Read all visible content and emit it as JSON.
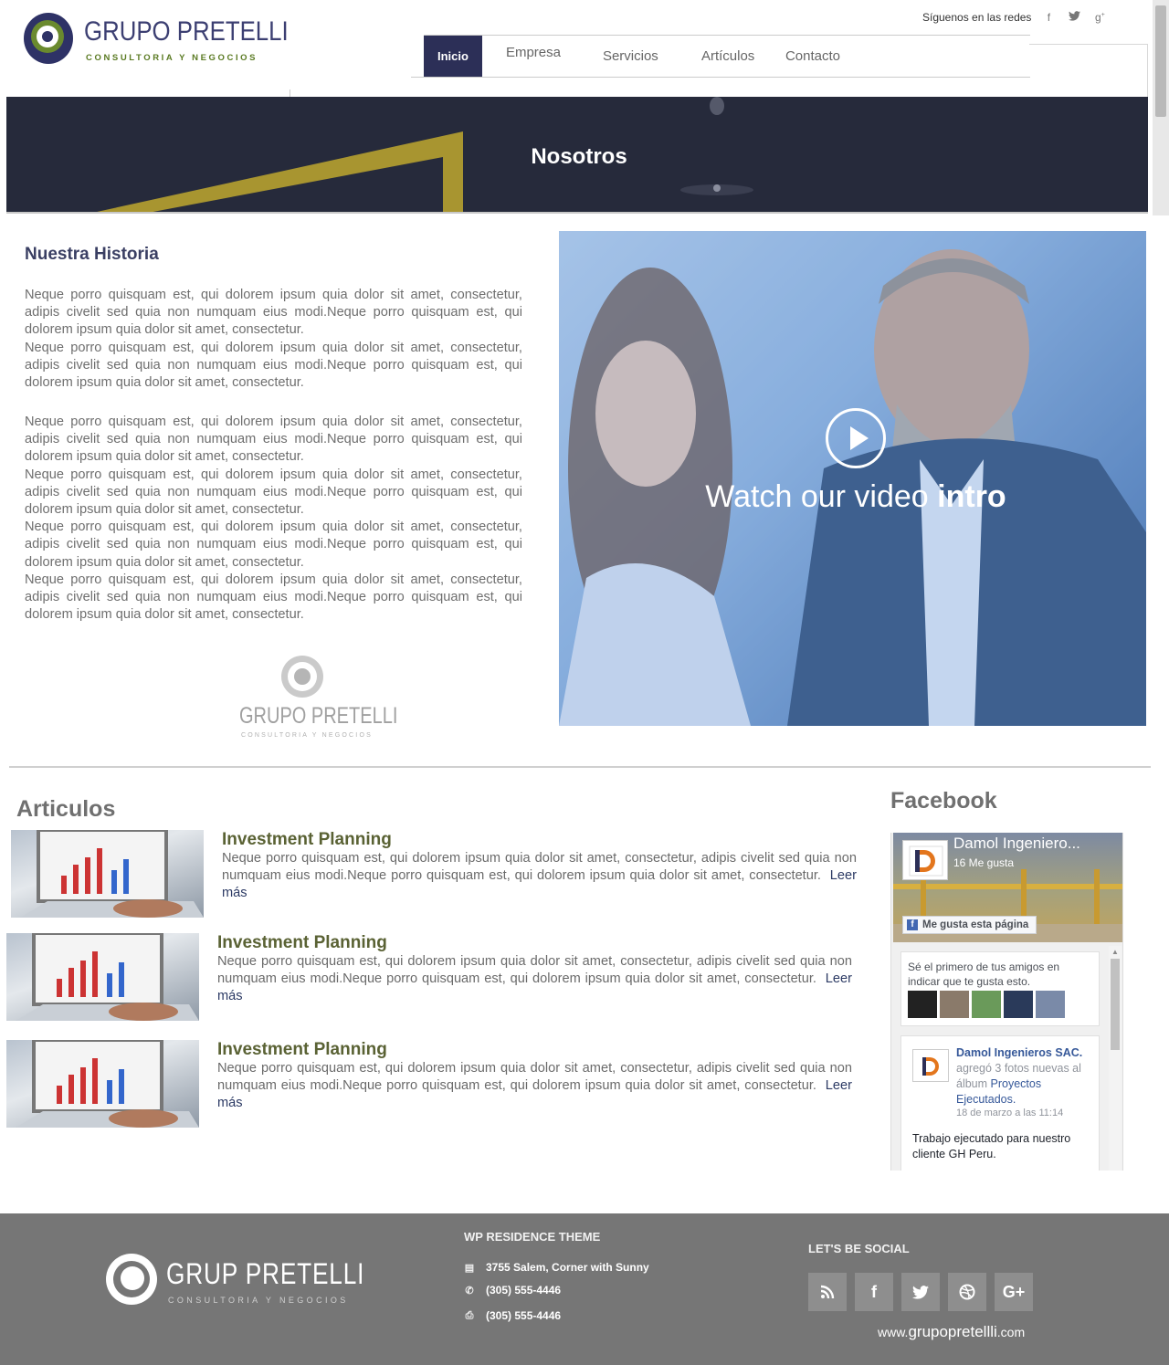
{
  "brand": {
    "name": "GRUPO PRETELLI",
    "tagline": "CONSULTORIA Y NEGOCIOS"
  },
  "header": {
    "social_label": "Síguenos en las redes",
    "social_icons": [
      "facebook-icon",
      "twitter-icon",
      "google-plus-icon"
    ]
  },
  "nav": {
    "items": [
      {
        "label": "Inicio",
        "active": true
      },
      {
        "label": "Empresa"
      },
      {
        "label": "Servicios"
      },
      {
        "label": "Artículos"
      },
      {
        "label": "Contacto"
      }
    ]
  },
  "hero": {
    "title": "Nosotros"
  },
  "story": {
    "heading": "Nuestra Historia",
    "p1": "Neque porro quisquam est, qui dolorem ipsum quia dolor sit amet, consectetur, adipis civelit sed quia non numquam eius modi.Neque porro quisquam est, qui dolorem ipsum quia dolor sit amet, consectetur.\nNeque porro quisquam est, qui dolorem ipsum quia dolor sit amet, consectetur, adipis civelit sed quia non numquam eius modi.Neque porro quisquam est, qui dolorem ipsum quia dolor sit amet, consectetur.",
    "p2": "Neque porro quisquam est, qui dolorem ipsum quia dolor sit amet, consectetur, adipis civelit sed quia non numquam eius modi.Neque porro quisquam est, qui dolorem ipsum quia dolor sit amet, consectetur.\nNeque porro quisquam est, qui dolorem ipsum quia dolor sit amet, consectetur, adipis civelit sed quia non numquam eius modi.Neque porro quisquam est, qui dolorem ipsum quia dolor sit amet, consectetur.\nNeque porro quisquam est, qui dolorem ipsum quia dolor sit amet, consectetur, adipis civelit sed quia non numquam eius modi.Neque porro quisquam est, qui dolorem ipsum quia dolor sit amet, consectetur.\nNeque porro quisquam est, qui dolorem ipsum quia dolor sit amet, consectetur, adipis civelit sed quia non numquam eius modi.Neque porro quisquam est, qui dolorem ipsum quia dolor sit amet, consectetur."
  },
  "video": {
    "caption_light": "Watch our video",
    "caption_bold": "intro"
  },
  "articles": {
    "heading": "Articulos",
    "items": [
      {
        "title": "Investment Planning",
        "body": "Neque porro quisquam est, qui dolorem ipsum quia dolor sit amet, consectetur, adipis civelit sed quia non numquam eius modi.Neque porro quisquam est, qui dolorem ipsum quia dolor sit amet, consectetur.",
        "more": "Leer más"
      },
      {
        "title": "Investment Planning",
        "body": "Neque porro quisquam est, qui dolorem ipsum quia dolor sit amet, consectetur, adipis civelit sed quia non numquam eius modi.Neque porro quisquam est, qui dolorem ipsum quia dolor sit amet, consectetur.",
        "more": "Leer más"
      },
      {
        "title": "Investment Planning",
        "body": "Neque porro quisquam est, qui dolorem ipsum quia dolor sit amet, consectetur, adipis civelit sed quia non numquam eius modi.Neque porro quisquam est, qui dolorem ipsum quia dolor sit amet, consectetur.",
        "more": "Leer más"
      }
    ]
  },
  "facebook": {
    "heading": "Facebook",
    "page_name": "Damol Ingeniero...",
    "likes": "16 Me gusta",
    "like_button": "Me gusta esta página",
    "friends_text": "Sé el primero de tus amigos en indicar que te gusta esto.",
    "post_author": "Damol Ingenieros SAC.",
    "post_action": "agregó 3 fotos nuevas al álbum",
    "post_album": "Proyectos Ejecutados.",
    "post_date": "18 de marzo a las 11:14",
    "post_message": "Trabajo ejecutado para nuestro cliente GH Peru."
  },
  "footer": {
    "logo_name": "GRUP   PRETELLI",
    "logo_tagline": "CONSULTORIA Y NEGOCIOS",
    "contact_title": "WP RESIDENCE THEME",
    "address": "3755 Salem, Corner with Sunny",
    "phone": "(305) 555-4446",
    "fax": "(305) 555-4446",
    "social_title": "LET'S BE SOCIAL",
    "social_icons": [
      "rss-icon",
      "facebook-icon",
      "twitter-icon",
      "dribbble-icon",
      "google-plus-icon"
    ],
    "url_prefix": "www.",
    "url_main": "grupopretellli",
    "url_suffix": ".com"
  },
  "colors": {
    "navy": "#2c2f57",
    "olive": "#6a8a2e",
    "gold": "#a89530",
    "footer_gray": "#767676"
  }
}
